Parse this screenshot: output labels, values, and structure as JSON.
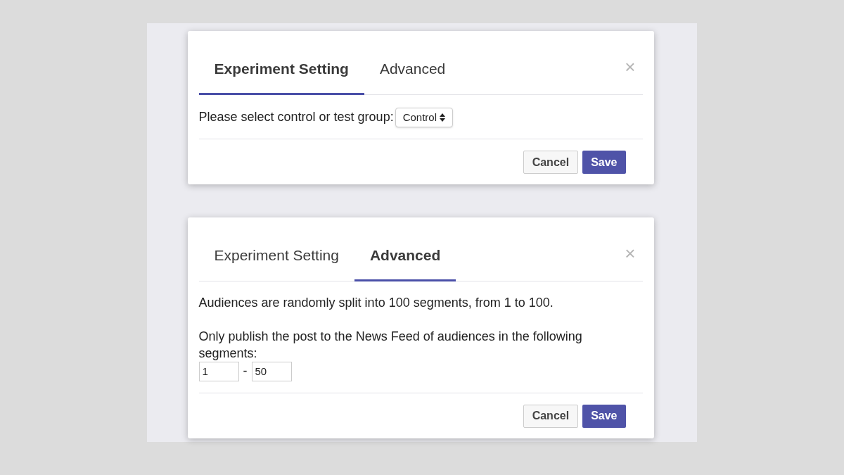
{
  "dialogs": [
    {
      "tabs": [
        {
          "label": "Experiment Setting",
          "selected": true
        },
        {
          "label": "Advanced",
          "selected": false
        }
      ],
      "close": "×",
      "body": [
        {
          "kind": "select_row",
          "label": "Please select control or test group:",
          "value": "Control"
        }
      ],
      "buttons": [
        "Cancel",
        "Save"
      ]
    },
    {
      "tabs": [
        {
          "label": "Experiment Setting",
          "selected": false
        },
        {
          "label": "Advanced",
          "selected": true
        }
      ],
      "close": "×",
      "body": [
        {
          "kind": "paragraph",
          "text": "Audiences are randomly split into 100 segments, from 1 to 100."
        },
        {
          "kind": "paragraph",
          "text": "Only publish the post to the News Feed of audiences in the following segments:"
        },
        {
          "kind": "range",
          "from": "1",
          "separator": "-",
          "to": "50"
        }
      ],
      "buttons": [
        "Cancel",
        "Save"
      ]
    }
  ]
}
